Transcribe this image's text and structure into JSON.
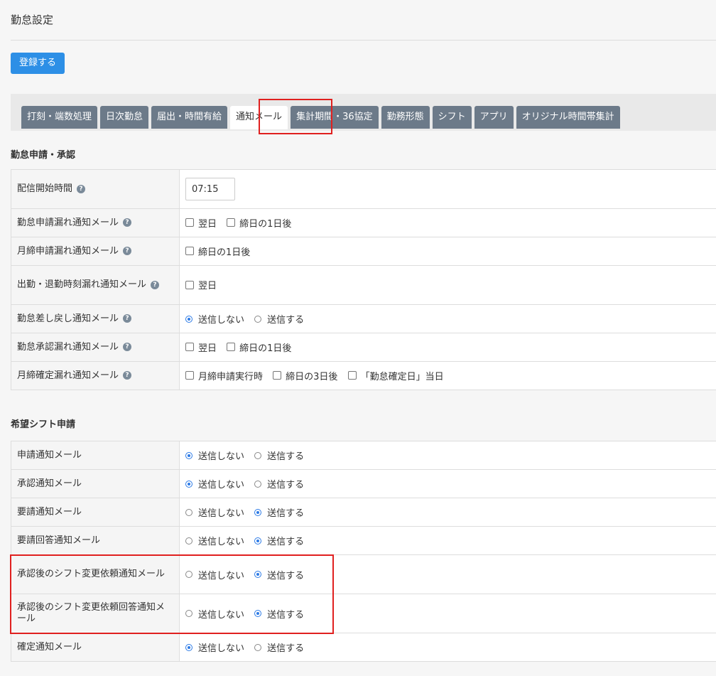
{
  "page": {
    "title": "勤怠設定"
  },
  "actions": {
    "register_label": "登録する"
  },
  "tabs": [
    {
      "label": "打刻・端数処理",
      "active": false
    },
    {
      "label": "日次勤怠",
      "active": false
    },
    {
      "label": "届出・時間有給",
      "active": false
    },
    {
      "label": "通知メール",
      "active": true
    },
    {
      "label": "集計期間・36協定",
      "active": false
    },
    {
      "label": "勤務形態",
      "active": false
    },
    {
      "label": "シフト",
      "active": false
    },
    {
      "label": "アプリ",
      "active": false
    },
    {
      "label": "オリジナル時間帯集計",
      "active": false
    }
  ],
  "attendance_section": {
    "heading": "勤怠申請・承認",
    "delivery_time": {
      "label": "配信開始時間",
      "value": "07:15"
    },
    "rows": [
      {
        "label": "勤怠申請漏れ通知メール",
        "options": [
          {
            "label": "翌日",
            "checked": false
          },
          {
            "label": "締日の1日後",
            "checked": false
          }
        ]
      },
      {
        "label": "月締申請漏れ通知メール",
        "options": [
          {
            "label": "締日の1日後",
            "checked": false
          }
        ]
      },
      {
        "label": "出勤・退勤時刻漏れ通知メール",
        "options": [
          {
            "label": "翌日",
            "checked": false
          }
        ]
      },
      {
        "label": "勤怠差し戻し通知メール",
        "radio": [
          {
            "label": "送信しない",
            "selected": true
          },
          {
            "label": "送信する",
            "selected": false
          }
        ]
      },
      {
        "label": "勤怠承認漏れ通知メール",
        "options": [
          {
            "label": "翌日",
            "checked": false
          },
          {
            "label": "締日の1日後",
            "checked": false
          }
        ]
      },
      {
        "label": "月締確定漏れ通知メール",
        "options": [
          {
            "label": "月締申請実行時",
            "checked": false
          },
          {
            "label": "締日の3日後",
            "checked": false
          },
          {
            "label": "「勤怠確定日」当日",
            "checked": false
          }
        ]
      }
    ]
  },
  "shift_section": {
    "heading": "希望シフト申請",
    "rows": [
      {
        "label": "申請通知メール",
        "radio": [
          {
            "label": "送信しない",
            "selected": true
          },
          {
            "label": "送信する",
            "selected": false
          }
        ]
      },
      {
        "label": "承認通知メール",
        "radio": [
          {
            "label": "送信しない",
            "selected": true
          },
          {
            "label": "送信する",
            "selected": false
          }
        ]
      },
      {
        "label": "要請通知メール",
        "radio": [
          {
            "label": "送信しない",
            "selected": false
          },
          {
            "label": "送信する",
            "selected": true
          }
        ]
      },
      {
        "label": "要請回答通知メール",
        "radio": [
          {
            "label": "送信しない",
            "selected": false
          },
          {
            "label": "送信する",
            "selected": true
          }
        ]
      },
      {
        "label": "承認後のシフト変更依頼通知メール",
        "radio": [
          {
            "label": "送信しない",
            "selected": false
          },
          {
            "label": "送信する",
            "selected": true
          }
        ]
      },
      {
        "label": "承認後のシフト変更依頼回答通知メール",
        "radio": [
          {
            "label": "送信しない",
            "selected": false
          },
          {
            "label": "送信する",
            "selected": true
          }
        ]
      },
      {
        "label": "確定通知メール",
        "radio": [
          {
            "label": "送信しない",
            "selected": true
          },
          {
            "label": "送信する",
            "selected": false
          }
        ]
      }
    ]
  },
  "colors": {
    "accent": "#2d8fe6",
    "tab": "#6c7a89",
    "highlight": "#e0201f"
  }
}
